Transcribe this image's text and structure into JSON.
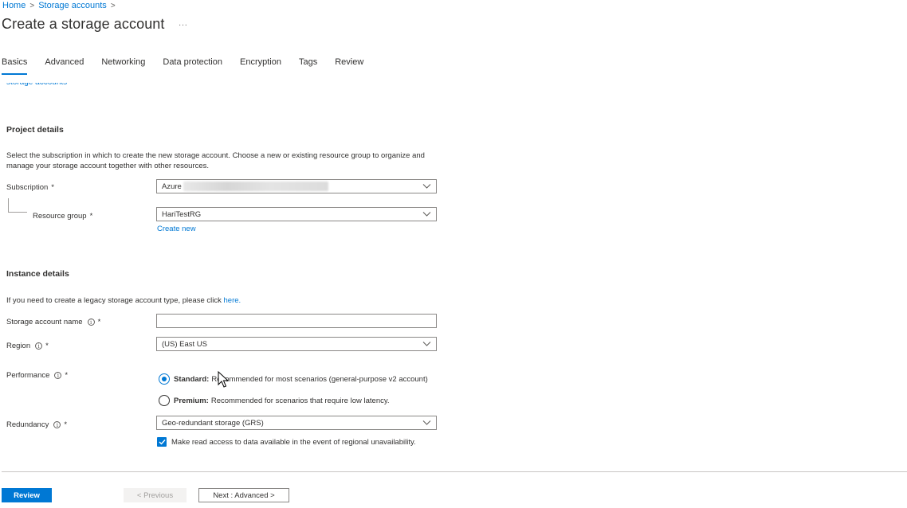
{
  "breadcrumb": {
    "home": "Home",
    "storage_accounts": "Storage accounts",
    "sep": ">"
  },
  "page": {
    "title": "Create a storage account",
    "more": "···"
  },
  "tabs": [
    {
      "label": "Basics",
      "active": true
    },
    {
      "label": "Advanced"
    },
    {
      "label": "Networking"
    },
    {
      "label": "Data protection"
    },
    {
      "label": "Encryption"
    },
    {
      "label": "Tags"
    },
    {
      "label": "Review"
    }
  ],
  "top_link": "storage accounts",
  "project": {
    "title": "Project details",
    "description_line1": "Select the subscription in which to create the new storage account. Choose a new or existing resource group to organize and",
    "description_line2": "manage your storage account together with other resources.",
    "subscription_label": "Subscription",
    "subscription_value": "Azure",
    "resource_group_label": "Resource group",
    "resource_group_value": "HariTestRG",
    "create_new": "Create new",
    "required_mark": "*"
  },
  "instance": {
    "title": "Instance details",
    "legacy_text": "If you need to create a legacy storage account type, please click",
    "legacy_link": "here.",
    "name_label": "Storage account name",
    "name_value": "",
    "region_label": "Region",
    "region_value": "(US) East US",
    "performance_label": "Performance",
    "standard_bold": "Standard:",
    "standard_desc": "Recommended for most scenarios (general-purpose v2 account)",
    "premium_bold": "Premium:",
    "premium_desc": "Recommended for scenarios that require low latency.",
    "performance_selected": "standard",
    "redundancy_label": "Redundancy",
    "redundancy_value": "Geo-redundant storage (GRS)",
    "read_access_label": "Make read access to data available in the event of regional unavailability.",
    "read_access_checked": true,
    "info_glyph": "i"
  },
  "footer": {
    "review": "Review",
    "previous": "< Previous",
    "next": "Next : Advanced >"
  },
  "colors": {
    "accent": "#0078d4",
    "text": "#323130",
    "border": "#8a8886"
  },
  "icons": [
    "chevron-right-icon",
    "more-icon",
    "chevron-down-icon",
    "info-icon",
    "checkmark-icon",
    "mouse-cursor-icon"
  ]
}
